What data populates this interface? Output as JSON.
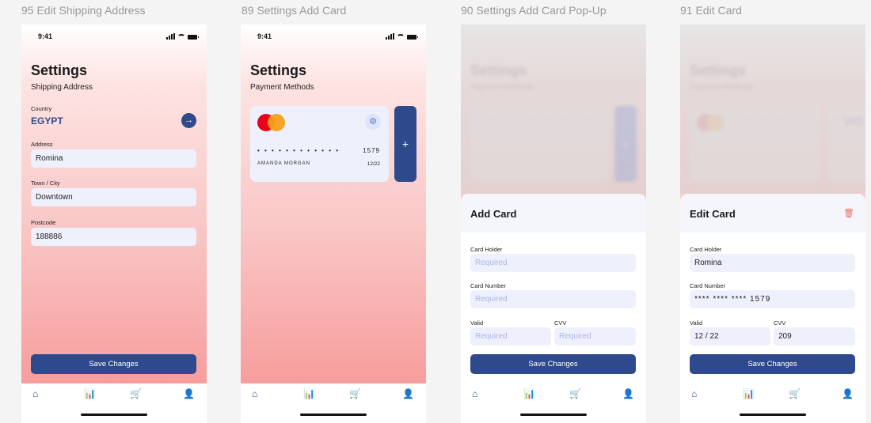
{
  "frames": [
    {
      "title": "95 Edit Shipping Address",
      "status_time": "9:41",
      "heading": "Settings",
      "subheading": "Shipping Address",
      "country_label": "Country",
      "country_value": "EGYPT",
      "address_label": "Address",
      "address_value": "Romina",
      "city_label": "Town / City",
      "city_value": "Downtown",
      "postcode_label": "Postcode",
      "postcode_value": "188886",
      "save_label": "Save Changes"
    },
    {
      "title": "89 Settings Add Card",
      "status_time": "9:41",
      "heading": "Settings",
      "subheading": "Payment Methods",
      "card": {
        "masked": "• • • •   • • • •   • • • •",
        "last4": "1579",
        "holder": "AMANDA MORGAN",
        "expiry": "12/22"
      },
      "add_label": "+"
    },
    {
      "title": "90 Settings Add Card Pop-Up",
      "sheet_title": "Add Card",
      "holder_label": "Card Holder",
      "holder_placeholder": "Required",
      "number_label": "Card Number",
      "number_placeholder": "Required",
      "valid_label": "Valid",
      "valid_placeholder": "Required",
      "cvv_label": "CVV",
      "cvv_placeholder": "Required",
      "save_label": "Save Changes"
    },
    {
      "title": "91 Edit Card",
      "sheet_title": "Edit Card",
      "holder_label": "Card Holder",
      "holder_value": "Romina",
      "number_label": "Card Number",
      "number_value": "**** **** **** 1579",
      "valid_label": "Valid",
      "valid_value": "12 / 22",
      "cvv_label": "CVV",
      "cvv_value": "209",
      "save_label": "Save Changes"
    }
  ],
  "tabbar": {
    "home_icon": "⌂",
    "stats_icon": "📊",
    "cart_icon": "🛒",
    "user_icon": "👤"
  },
  "colors": {
    "primary": "#2e4a8c",
    "accent": "#ee6b6b",
    "field": "#eef1fc"
  }
}
